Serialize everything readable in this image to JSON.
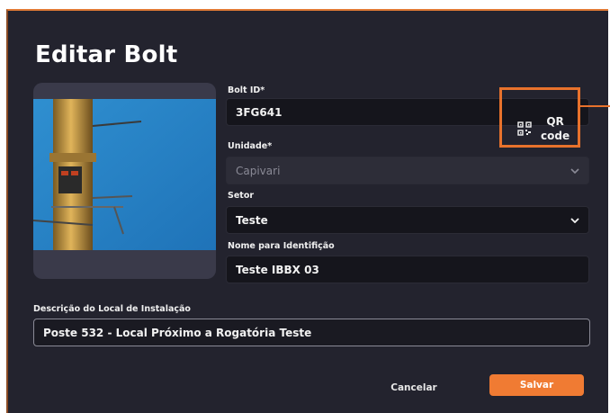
{
  "modal": {
    "title": "Editar Bolt"
  },
  "form": {
    "bolt_id": {
      "label": "Bolt ID*",
      "value": "3FG641"
    },
    "qr_button": {
      "line1": "QR",
      "line2": "code"
    },
    "unidade": {
      "label": "Unidade*",
      "value": "Capivari"
    },
    "setor": {
      "label": "Setor",
      "value": "Teste"
    },
    "nome": {
      "label": "Nome para Identifição",
      "value": "Teste IBBX 03"
    },
    "descricao": {
      "label": "Descrição do Local de Instalação",
      "value": "Poste 532 - Local Próximo a Rogatória Teste"
    }
  },
  "actions": {
    "cancel_label": "Cancelar",
    "save_label": "Salvar"
  },
  "colors": {
    "accent": "#f07b33",
    "background": "#23232e",
    "field": "#15151c"
  },
  "icons": [
    "qr-code-icon",
    "chevron-down-icon"
  ]
}
